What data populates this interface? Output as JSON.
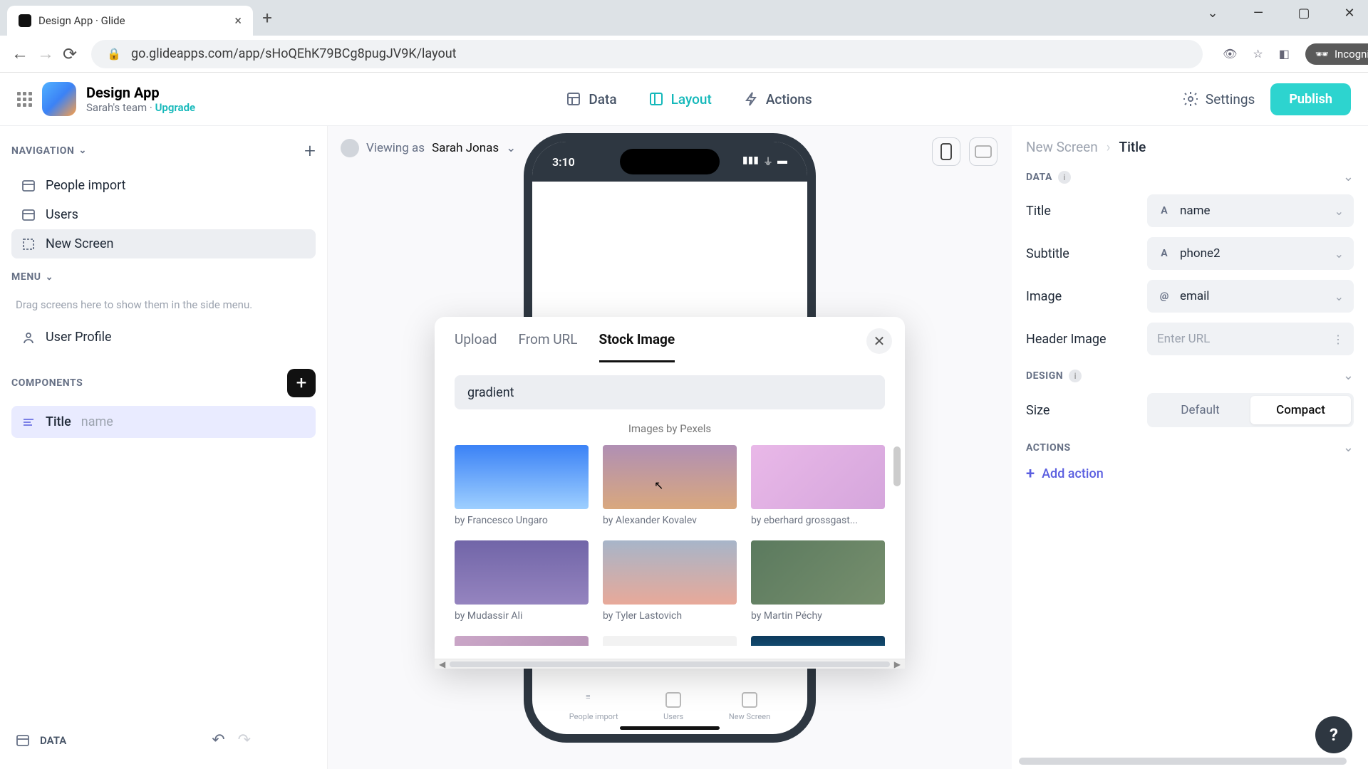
{
  "browser": {
    "tab_title": "Design App · Glide",
    "url": "go.glideapps.com/app/sHoQEhK79BCg8pugJV9K/layout",
    "incognito_label": "Incognito"
  },
  "header": {
    "app_name": "Design App",
    "team": "Sarah's team",
    "upgrade": "Upgrade",
    "tabs": {
      "data": "Data",
      "layout": "Layout",
      "actions": "Actions"
    },
    "settings": "Settings",
    "publish": "Publish"
  },
  "left": {
    "section_nav": "NAVIGATION",
    "nav_items": [
      "People import",
      "Users",
      "New Screen"
    ],
    "section_menu": "MENU",
    "menu_hint": "Drag screens here to show them in the side menu.",
    "menu_items": [
      "User Profile"
    ],
    "section_components": "COMPONENTS",
    "component": {
      "label": "Title",
      "sub": "name"
    },
    "footer_data": "DATA"
  },
  "canvas": {
    "viewing_as_prefix": "Viewing as",
    "viewing_as_user": "Sarah Jonas",
    "phone_time": "3:10",
    "phone_tabs": [
      "People import",
      "Users",
      "New Screen"
    ]
  },
  "modal": {
    "tabs": {
      "upload": "Upload",
      "from_url": "From URL",
      "stock": "Stock Image"
    },
    "search_value": "gradient",
    "images_by": "Images by Pexels",
    "thumbs": [
      {
        "author": "by Francesco Ungaro"
      },
      {
        "author": "by Alexander Kovalev"
      },
      {
        "author": "by eberhard grossgast..."
      },
      {
        "author": "by Mudassir Ali"
      },
      {
        "author": "by Tyler Lastovich"
      },
      {
        "author": "by Martin Péchy"
      }
    ]
  },
  "right": {
    "breadcrumb": {
      "a": "New Screen",
      "b": "Title"
    },
    "section_data": "DATA",
    "fields": {
      "title_label": "Title",
      "title_value": "name",
      "subtitle_label": "Subtitle",
      "subtitle_value": "phone2",
      "image_label": "Image",
      "image_value": "email",
      "header_image_label": "Header Image",
      "header_image_placeholder": "Enter URL"
    },
    "section_design": "DESIGN",
    "size_label": "Size",
    "size_options": {
      "default": "Default",
      "compact": "Compact"
    },
    "section_actions": "ACTIONS",
    "add_action": "Add action"
  },
  "help": "?"
}
